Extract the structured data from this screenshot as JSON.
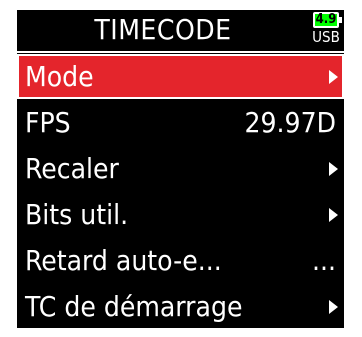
{
  "header": {
    "title": "TIMECODE",
    "battery_level": "4.9",
    "power_source": "USB"
  },
  "menu": {
    "items": [
      {
        "label": "Mode",
        "value": "",
        "has_arrow": true,
        "selected": true
      },
      {
        "label": "FPS",
        "value": "29.97D",
        "has_arrow": false,
        "selected": false
      },
      {
        "label": "Recaler",
        "value": "",
        "has_arrow": true,
        "selected": false
      },
      {
        "label": "Bits util.",
        "value": "",
        "has_arrow": true,
        "selected": false
      },
      {
        "label": "Retard auto-e...",
        "value": "...",
        "has_arrow": false,
        "selected": false
      },
      {
        "label": "TC de démarrage",
        "value": "",
        "has_arrow": true,
        "selected": false
      }
    ]
  },
  "colors": {
    "background": "#000000",
    "selection": "#e4252c",
    "battery": "#00ff00",
    "text": "#ffffff"
  }
}
